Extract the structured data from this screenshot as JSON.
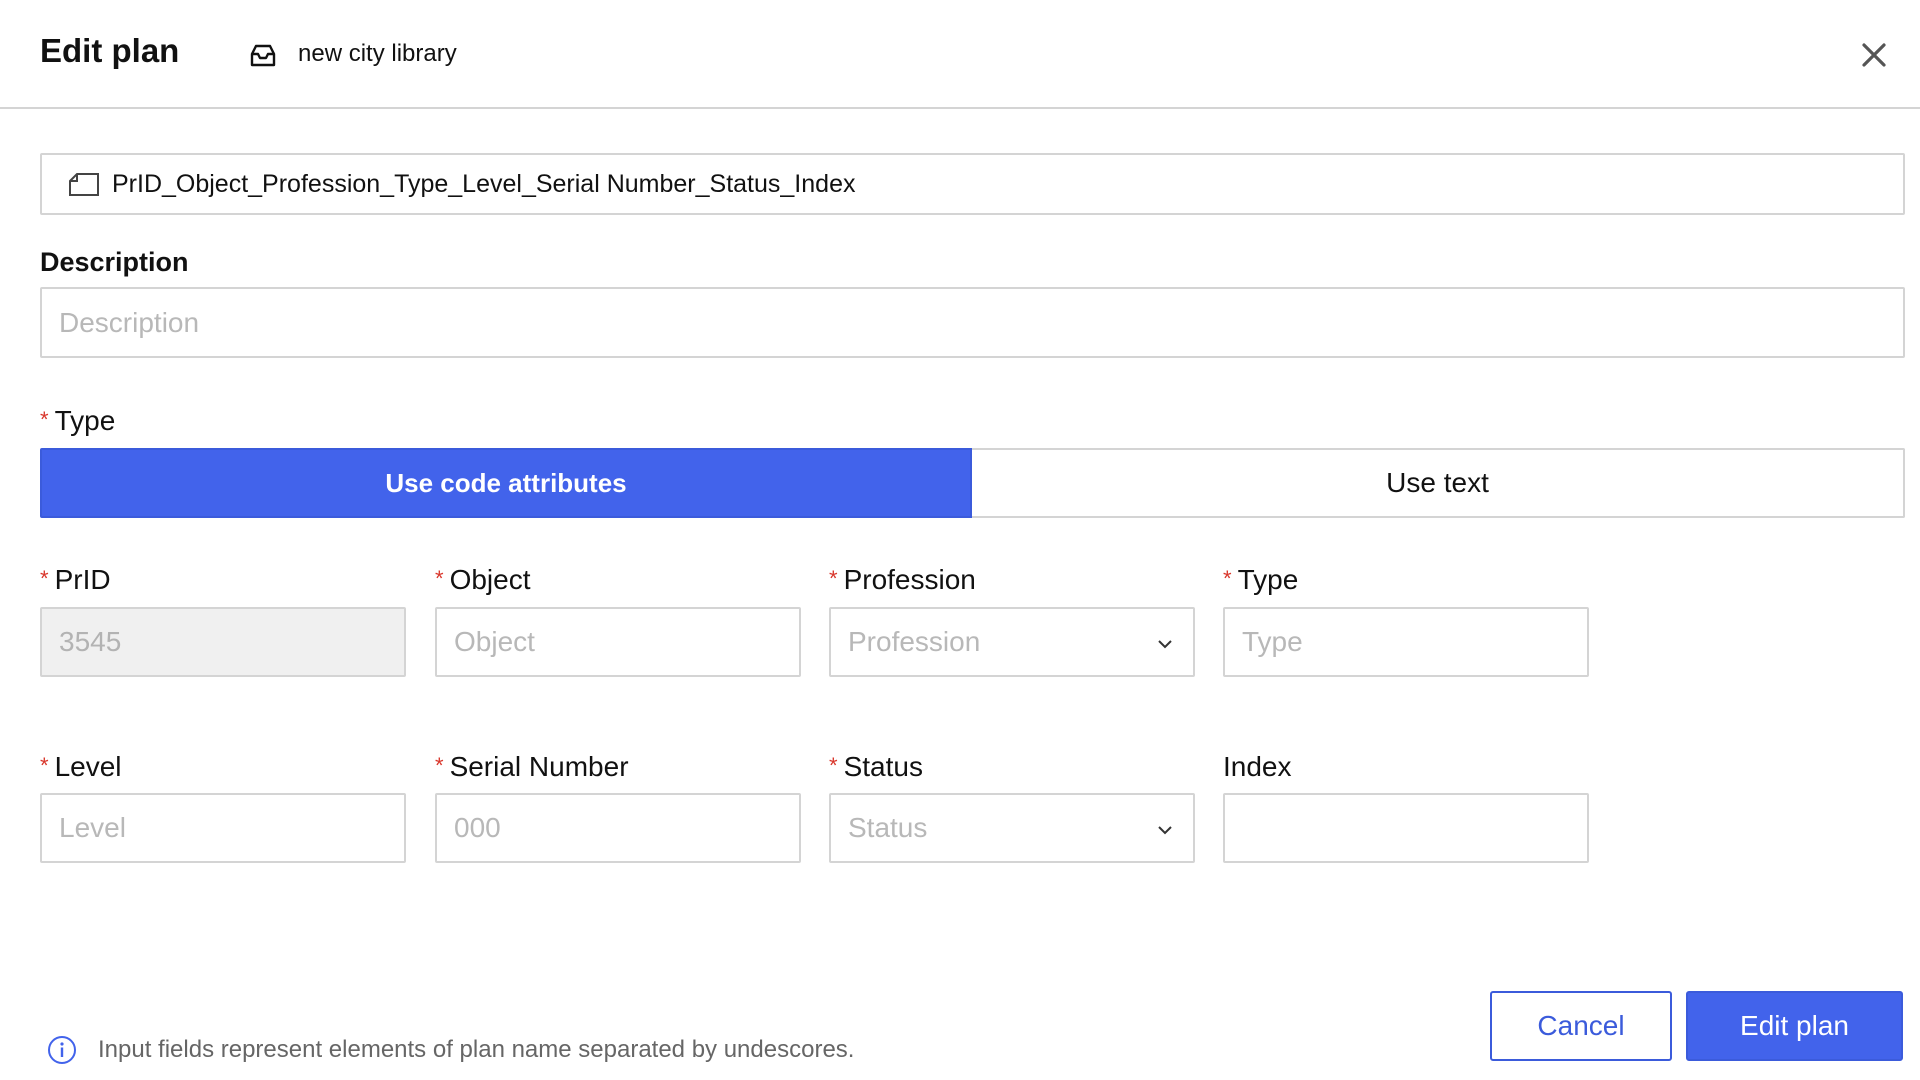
{
  "header": {
    "title": "Edit plan",
    "project_name": "new city library",
    "project_icon": "inbox-icon",
    "close_icon": "close-icon"
  },
  "plan_name": {
    "icon": "tag-icon",
    "value": "PrID_Object_Profession_Type_Level_Serial Number_Status_Index"
  },
  "description": {
    "label": "Description",
    "placeholder": "Description",
    "value": ""
  },
  "type_selector": {
    "label": "Type",
    "required": "*",
    "options": [
      "Use code attributes",
      "Use text"
    ],
    "selected": "Use code attributes"
  },
  "fields": {
    "prid": {
      "label": "PrID",
      "required": "*",
      "value": "3545",
      "placeholder": "",
      "disabled": true
    },
    "object": {
      "label": "Object",
      "required": "*",
      "value": "",
      "placeholder": "Object"
    },
    "profession": {
      "label": "Profession",
      "required": "*",
      "value": "",
      "placeholder": "Profession",
      "kind": "select"
    },
    "type": {
      "label": "Type",
      "required": "*",
      "value": "",
      "placeholder": "Type"
    },
    "level": {
      "label": "Level",
      "required": "*",
      "value": "",
      "placeholder": "Level"
    },
    "serial_number": {
      "label": "Serial Number",
      "required": "*",
      "value": "",
      "placeholder": "000"
    },
    "status": {
      "label": "Status",
      "required": "*",
      "value": "",
      "placeholder": "Status",
      "kind": "select"
    },
    "index": {
      "label": "Index",
      "required": "",
      "value": "",
      "placeholder": ""
    }
  },
  "footer": {
    "info_icon": "info-icon",
    "info_text": "Input fields represent elements of plan name separated by undescores.",
    "cancel_label": "Cancel",
    "submit_label": "Edit plan"
  },
  "colors": {
    "accent": "#4263eb",
    "required": "#d9362b",
    "border": "#d4d4d4",
    "placeholder": "#b8b8b8"
  }
}
